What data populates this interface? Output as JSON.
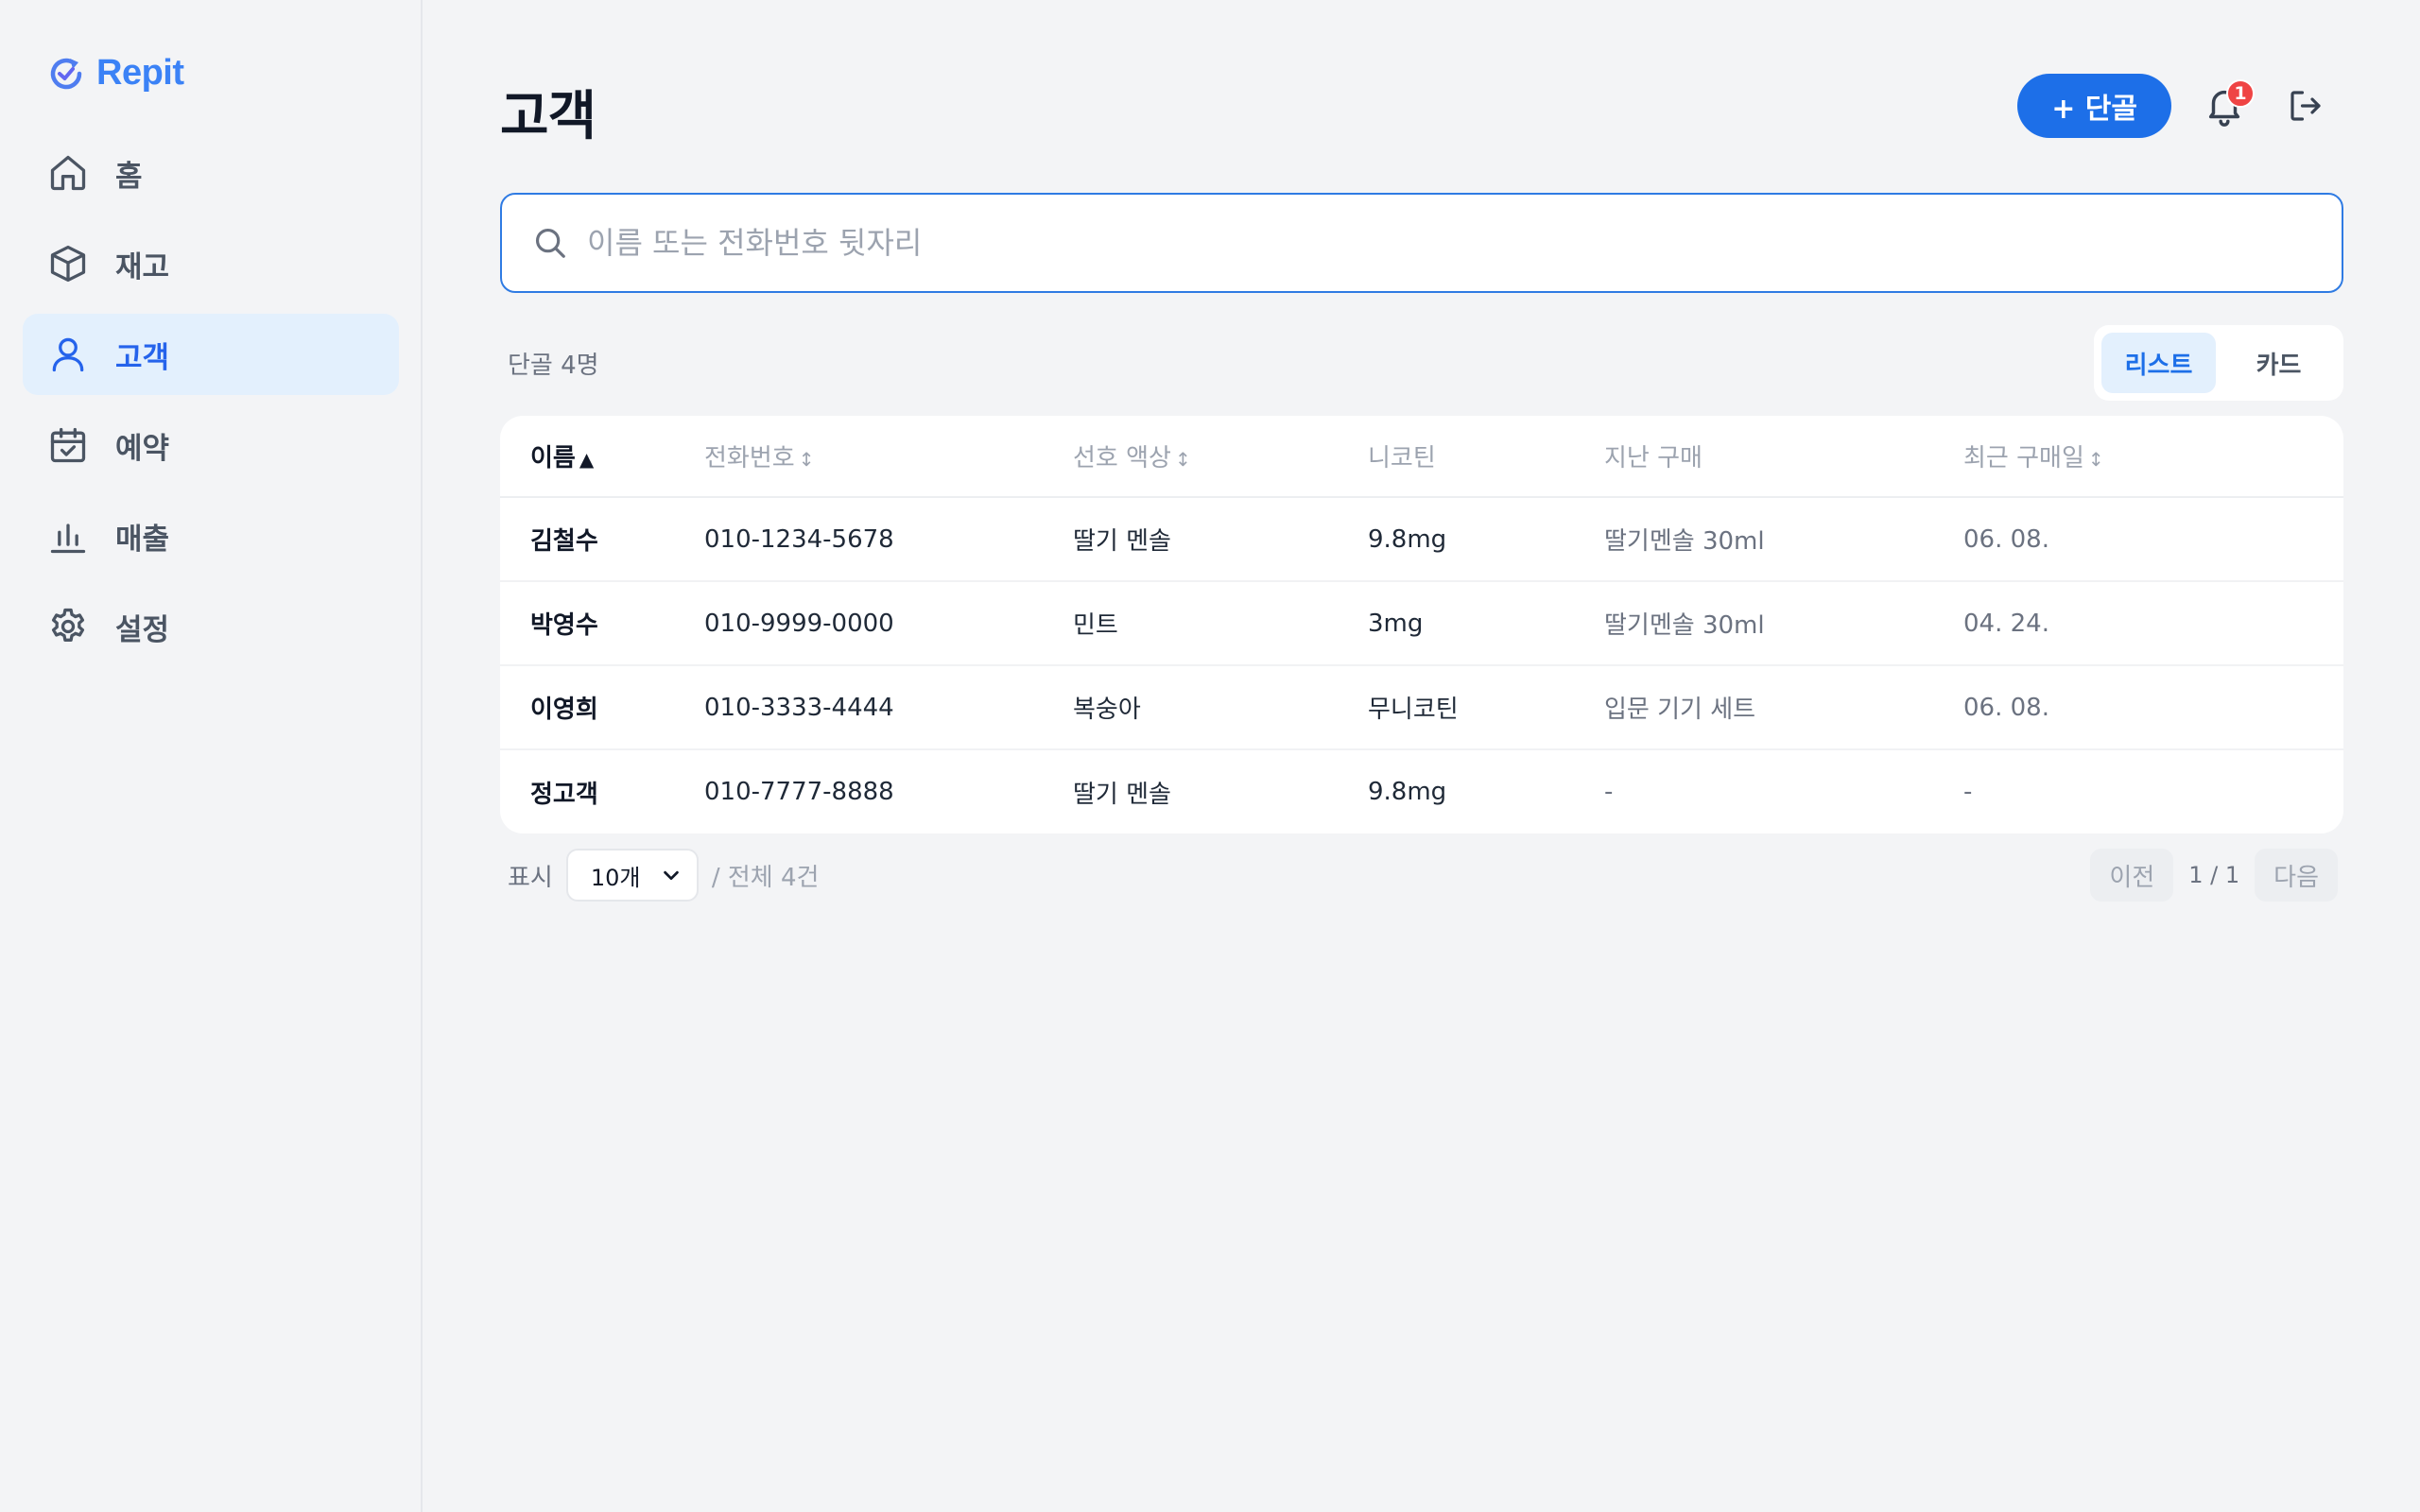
{
  "app": {
    "name": "Repit",
    "brand_color": "#3b82f6",
    "accent_color": "#1d6fe8"
  },
  "sidebar": {
    "items": [
      {
        "label": "홈",
        "icon": "home-icon",
        "active": false
      },
      {
        "label": "재고",
        "icon": "box-icon",
        "active": false
      },
      {
        "label": "고객",
        "icon": "user-icon",
        "active": true
      },
      {
        "label": "예약",
        "icon": "calendar-check-icon",
        "active": false
      },
      {
        "label": "매출",
        "icon": "bar-chart-icon",
        "active": false
      },
      {
        "label": "설정",
        "icon": "gear-icon",
        "active": false
      }
    ]
  },
  "header": {
    "title": "고객",
    "add_button_label": "+ 단골",
    "notification_count": "1"
  },
  "search": {
    "placeholder": "이름 또는 전화번호 뒷자리",
    "value": ""
  },
  "summary": {
    "count_label": "단골 4명"
  },
  "view_toggle": {
    "list_label": "리스트",
    "card_label": "카드",
    "selected": "리스트"
  },
  "table": {
    "columns": [
      {
        "label": "이름",
        "sort": "▲"
      },
      {
        "label": "전화번호",
        "sort": "↕"
      },
      {
        "label": "선호 액상",
        "sort": "↕"
      },
      {
        "label": "니코틴",
        "sort": ""
      },
      {
        "label": "지난 구매",
        "sort": ""
      },
      {
        "label": "최근 구매일",
        "sort": "↕"
      }
    ],
    "rows": [
      [
        "김철수",
        "010-1234-5678",
        "딸기 멘솔",
        "9.8mg",
        "딸기멘솔 30ml",
        "06. 08."
      ],
      [
        "박영수",
        "010-9999-0000",
        "민트",
        "3mg",
        "딸기멘솔 30ml",
        "04. 24."
      ],
      [
        "이영희",
        "010-3333-4444",
        "복숭아",
        "무니코틴",
        "입문 기기 세트",
        "06. 08."
      ],
      [
        "정고객",
        "010-7777-8888",
        "딸기 멘솔",
        "9.8mg",
        "-",
        "-"
      ]
    ]
  },
  "pagination": {
    "show_label": "표시",
    "per_page": "10개",
    "total_label": "/ 전체 4건",
    "prev_label": "이전",
    "page_info": "1 / 1",
    "next_label": "다음"
  }
}
